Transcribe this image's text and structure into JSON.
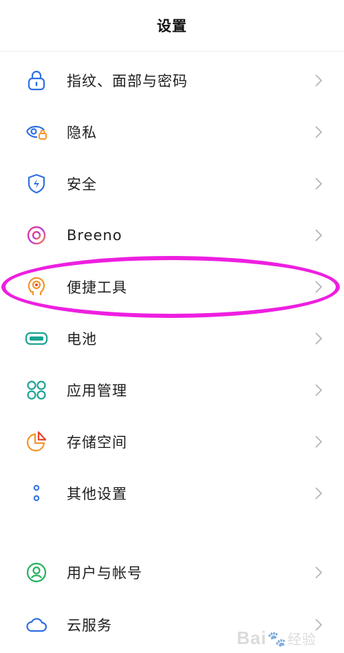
{
  "header": {
    "title": "设置"
  },
  "colors": {
    "blue": "#2f6fe3",
    "orange": "#f2952a",
    "teal": "#1aa394",
    "green": "#26b05e",
    "highlight": "#ee1fe0"
  },
  "items": [
    {
      "label": "指纹、面部与密码",
      "icon": "lock-icon"
    },
    {
      "label": "隐私",
      "icon": "privacy-eye-icon"
    },
    {
      "label": "安全",
      "icon": "shield-icon"
    },
    {
      "label": "Breeno",
      "icon": "breeno-icon"
    },
    {
      "label": "便捷工具",
      "icon": "convenience-tools-icon"
    },
    {
      "label": "电池",
      "icon": "battery-icon"
    },
    {
      "label": "应用管理",
      "icon": "app-management-icon"
    },
    {
      "label": "存储空间",
      "icon": "storage-pie-icon"
    },
    {
      "label": "其他设置",
      "icon": "other-settings-icon"
    },
    {
      "label": "用户与帐号",
      "icon": "user-icon"
    },
    {
      "label": "云服务",
      "icon": "cloud-icon"
    }
  ],
  "watermark": {
    "text1": "Bai",
    "text2": "经验"
  }
}
